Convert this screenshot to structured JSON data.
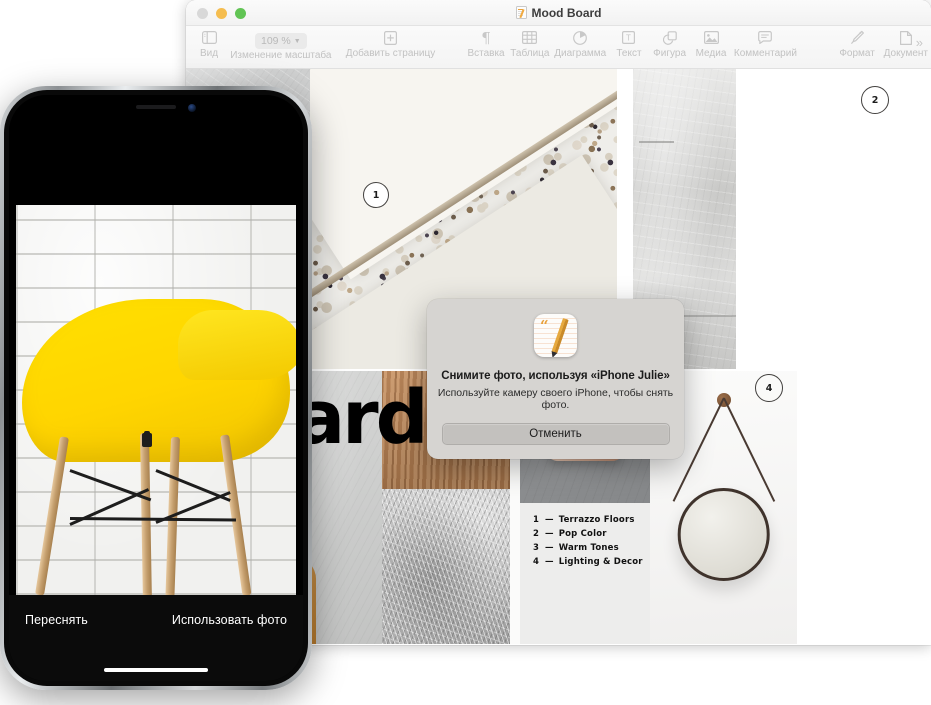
{
  "window": {
    "title": "Mood Board",
    "doc_icon": "pages-document-icon",
    "traffic_lights": [
      "close-button",
      "minimize-button",
      "maximize-button"
    ],
    "overflow_icon": "chevron-double-right-icon"
  },
  "toolbar": {
    "items": [
      {
        "label": "Вид",
        "icon": "sidebar-view-icon"
      },
      {
        "label": "Изменение масштаба",
        "icon": "zoom-level-popup",
        "value": "109 %"
      },
      {
        "label": "Добавить страницу",
        "icon": "add-page-icon"
      },
      {
        "label": "Вставка",
        "icon": "pilcrow-insert-icon"
      },
      {
        "label": "Таблица",
        "icon": "table-icon"
      },
      {
        "label": "Диаграмма",
        "icon": "chart-icon"
      },
      {
        "label": "Текст",
        "icon": "text-box-icon"
      },
      {
        "label": "Фигура",
        "icon": "shape-icon"
      },
      {
        "label": "Медиа",
        "icon": "media-image-icon"
      },
      {
        "label": "Комментарий",
        "icon": "comment-icon"
      },
      {
        "label": "Формат",
        "icon": "format-brush-icon"
      },
      {
        "label": "Документ",
        "icon": "document-icon"
      }
    ]
  },
  "canvas": {
    "headline": "Board.",
    "badges": [
      {
        "number": "1"
      },
      {
        "number": "2"
      },
      {
        "number": "4"
      }
    ],
    "legend": [
      {
        "num": "1",
        "dash": "—",
        "text": "Terrazzo Floors"
      },
      {
        "num": "2",
        "dash": "—",
        "text": "Pop Color"
      },
      {
        "num": "3",
        "dash": "—",
        "text": "Warm Tones"
      },
      {
        "num": "4",
        "dash": "—",
        "text": "Lighting & Decor"
      }
    ],
    "tiles": [
      {
        "name": "terrazzo-photo"
      },
      {
        "name": "concrete-wall-photo"
      },
      {
        "name": "plaster-wall-photo"
      },
      {
        "name": "tan-sofa-photo"
      },
      {
        "name": "wood-grain-photo"
      },
      {
        "name": "grey-fur-rug-photo"
      },
      {
        "name": "pendant-lamp-photo"
      },
      {
        "name": "round-mirror-photo"
      }
    ]
  },
  "dialog": {
    "icon": "pages-app-icon",
    "title": "Снимите фото, используя «iPhone Julie»",
    "subtitle": "Используйте камеру своего iPhone, чтобы снять фото.",
    "cancel_label": "Отменить"
  },
  "iphone": {
    "photo_subject": "yellow-eames-chair-photo",
    "retake_label": "Переснять",
    "use_photo_label": "Использовать фото"
  },
  "colors": {
    "accent_yellow": "#ffd500",
    "window_chrome": "#f4f4f4",
    "dialog_bg": "#d6d4d1",
    "toolbar_label": "#c2c2c2"
  }
}
